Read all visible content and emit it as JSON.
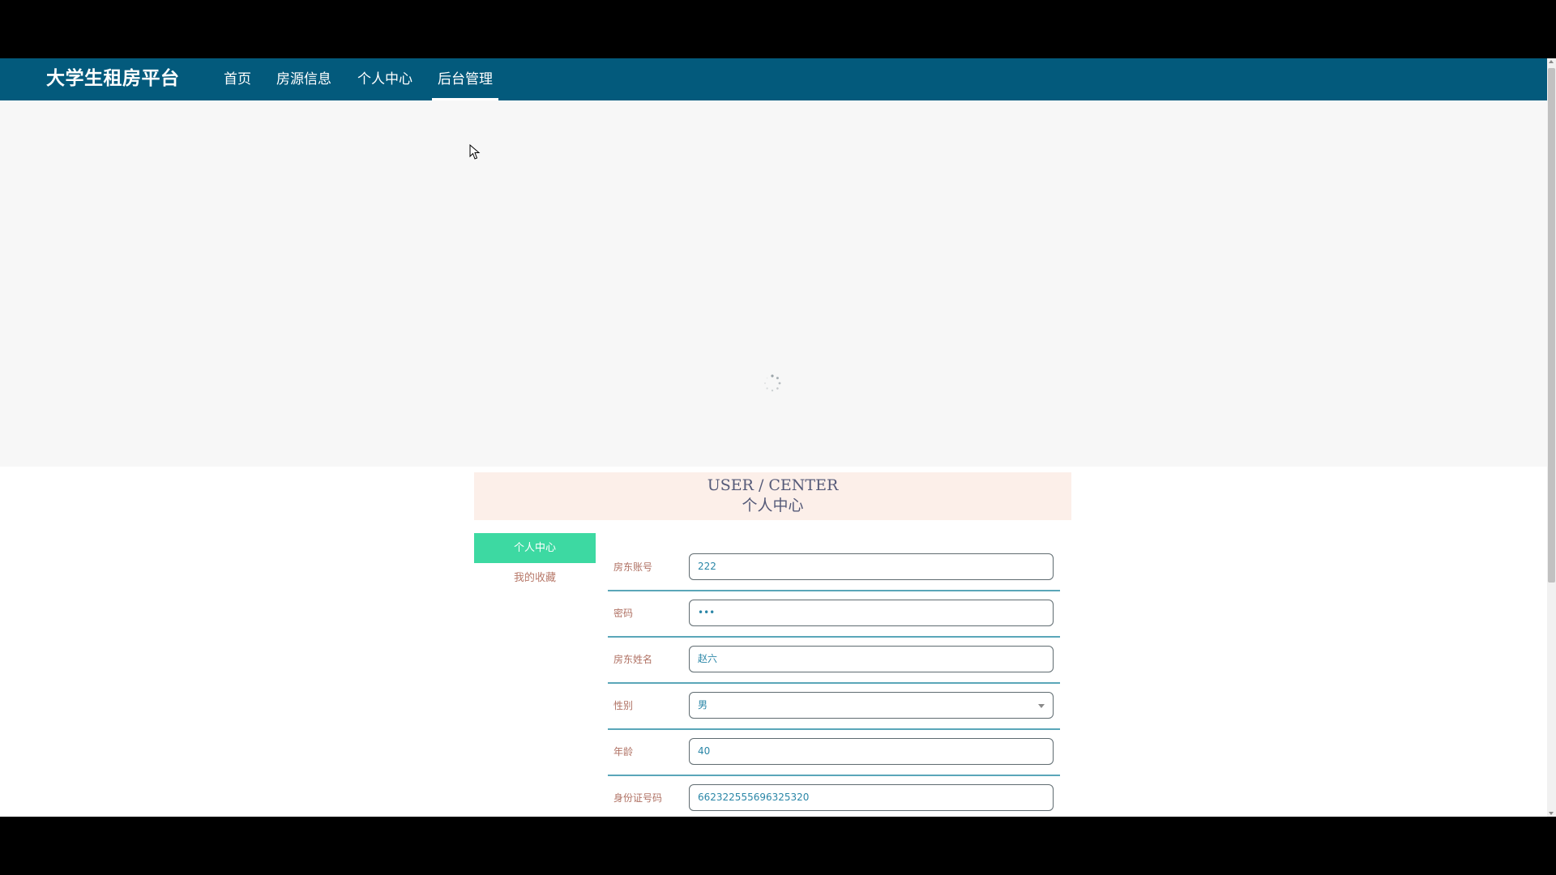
{
  "nav": {
    "brand": "大学生租房平台",
    "items": [
      {
        "label": "首页",
        "active": false
      },
      {
        "label": "房源信息",
        "active": false
      },
      {
        "label": "个人中心",
        "active": false
      },
      {
        "label": "后台管理",
        "active": true
      }
    ]
  },
  "section": {
    "title_en": "USER / CENTER",
    "title_cn": "个人中心"
  },
  "side_menu": {
    "items": [
      {
        "label": "个人中心",
        "active": true
      },
      {
        "label": "我的收藏",
        "active": false
      }
    ]
  },
  "form": {
    "fields": [
      {
        "label": "房东账号",
        "value": "222",
        "type": "text"
      },
      {
        "label": "密码",
        "value": "•••",
        "type": "password"
      },
      {
        "label": "房东姓名",
        "value": "赵六",
        "type": "text"
      },
      {
        "label": "性别",
        "value": "男",
        "type": "select"
      },
      {
        "label": "年龄",
        "value": "40",
        "type": "text"
      },
      {
        "label": "身份证号码",
        "value": "662322555696325320",
        "type": "text"
      }
    ]
  },
  "colors": {
    "nav_bg": "#035a7c",
    "active_menu": "#3dd9a2",
    "title_bg": "#fcefe9",
    "field_border": "#5aa6b9"
  }
}
